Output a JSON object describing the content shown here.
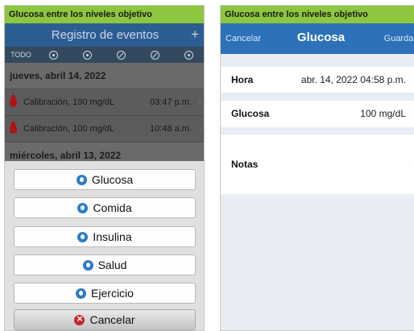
{
  "left": {
    "status_title": "Glucosa entre los niveles objetivo",
    "nav_title": "Registro de eventos",
    "add_symbol": "+",
    "filter_all": "TODO",
    "filters": [
      "glucosa",
      "comida",
      "insulina",
      "salud",
      "ejercicio"
    ],
    "day1": "jueves, abril 14, 2022",
    "events": [
      {
        "label": "Calibración, 190 mg/dL",
        "time": "03:47 p.m."
      },
      {
        "label": "Calibración, 100 mg/dL",
        "time": "10:48 a.m."
      }
    ],
    "day2": "miércoles, abril 13, 2022",
    "sheet_options": [
      {
        "label": "Glucosa",
        "icon": "drop-icon",
        "color": "#2a7cc7"
      },
      {
        "label": "Comida",
        "icon": "food-icon",
        "color": "#2a7cc7"
      },
      {
        "label": "Insulina",
        "icon": "syringe-icon",
        "color": "#2a7cc7"
      },
      {
        "label": "Salud",
        "icon": "health-icon",
        "color": "#2a7cc7"
      },
      {
        "label": "Ejercicio",
        "icon": "runner-icon",
        "color": "#2a7cc7"
      }
    ],
    "cancel_label": "Cancelar",
    "chevron": "›"
  },
  "right": {
    "status_title": "Glucosa entre los niveles objetivo",
    "cancel": "Cancelar",
    "title": "Glucosa",
    "save": "Guardar",
    "time_label": "Hora",
    "time_value": "abr. 14, 2022 04:58 p.m.",
    "glucose_label": "Glucosa",
    "glucose_value": "100 mg/dL",
    "notes_label": "Notas",
    "chevron": "›"
  },
  "colors": {
    "status_green": "#8dc63f",
    "nav_blue": "#2d72b8",
    "icon_blue": "#2a7cc7",
    "cancel_red": "#c5262d"
  }
}
